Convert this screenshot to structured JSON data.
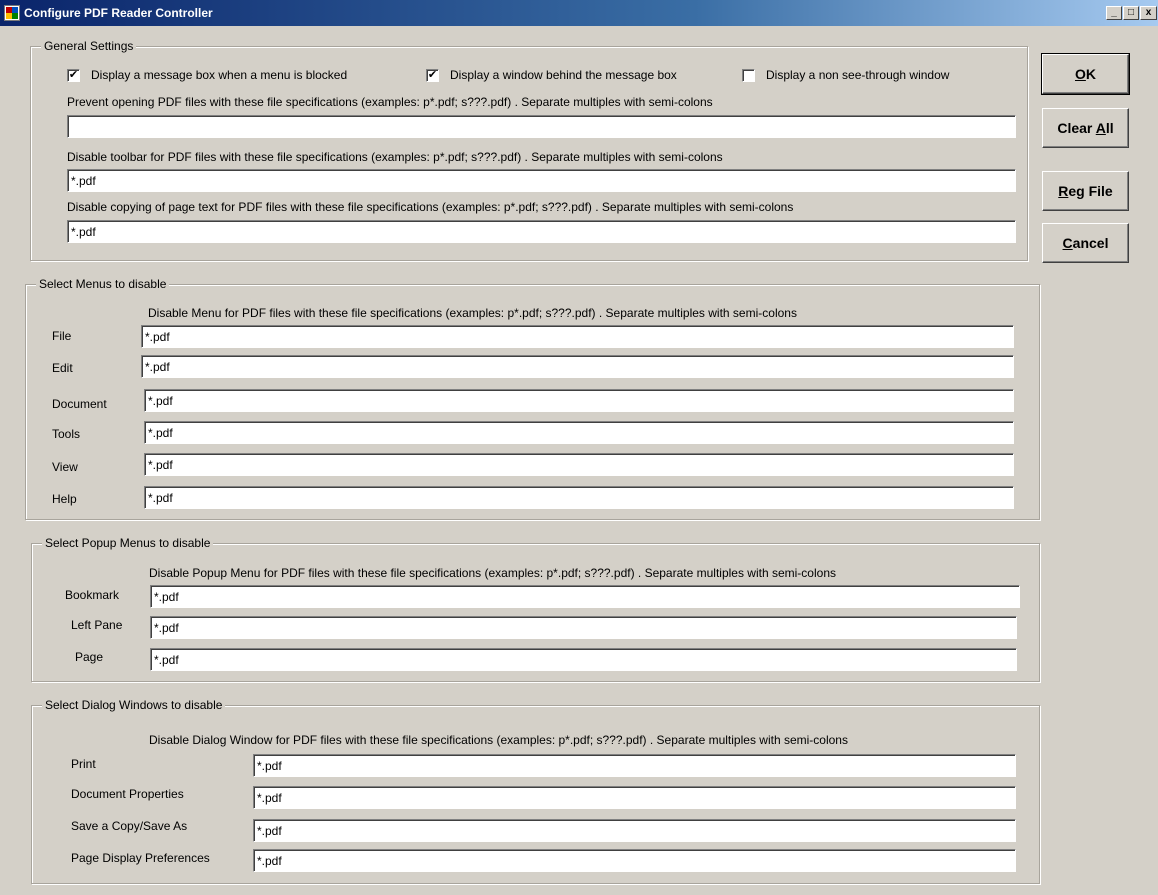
{
  "window": {
    "title": "Configure PDF Reader Controller",
    "minimize_glyph": "_",
    "maximize_glyph": "□",
    "close_glyph": "x"
  },
  "buttons": {
    "ok": {
      "accel": "O",
      "rest": "K"
    },
    "clear_all": {
      "pre": "Clear ",
      "accel": "A",
      "rest": "ll"
    },
    "reg_file": {
      "accel": "R",
      "rest": "eg File"
    },
    "cancel": {
      "accel": "C",
      "rest": "ancel"
    }
  },
  "general": {
    "legend": "General Settings",
    "checkboxes": [
      {
        "label": "Display a message box when a menu is blocked",
        "checked": true,
        "mark": "✔"
      },
      {
        "label": "Display a window behind the message box",
        "checked": true,
        "mark": "✔"
      },
      {
        "label": "Display a non see-through window",
        "checked": false,
        "mark": ""
      }
    ],
    "prevent_label": "Prevent opening PDF files with these file specifications (examples: p*.pdf; s???.pdf) . Separate multiples with semi-colons",
    "prevent_value": "",
    "toolbar_label": "Disable toolbar for PDF files with these file specifications (examples: p*.pdf; s???.pdf) . Separate multiples with semi-colons",
    "toolbar_value": "*.pdf",
    "copy_label": "Disable copying of page text for PDF files with these file specifications (examples: p*.pdf; s???.pdf) . Separate multiples with semi-colons",
    "copy_value": "*.pdf"
  },
  "menus": {
    "legend": "Select Menus to disable",
    "header": "Disable Menu for PDF files with these file specifications (examples: p*.pdf; s???.pdf) . Separate multiples with semi-colons",
    "rows": [
      {
        "label": "File",
        "value": "*.pdf"
      },
      {
        "label": "Edit",
        "value": "*.pdf"
      },
      {
        "label": "Document",
        "value": "*.pdf"
      },
      {
        "label": "Tools",
        "value": "*.pdf"
      },
      {
        "label": "View",
        "value": "*.pdf"
      },
      {
        "label": "Help",
        "value": "*.pdf"
      }
    ]
  },
  "popups": {
    "legend": "Select Popup Menus to disable",
    "header": "Disable Popup Menu for PDF files with these file specifications (examples: p*.pdf; s???.pdf) . Separate multiples with semi-colons",
    "rows": [
      {
        "label": "Bookmark",
        "value": "*.pdf"
      },
      {
        "label": "Left Pane",
        "value": "*.pdf"
      },
      {
        "label": "Page",
        "value": "*.pdf"
      }
    ]
  },
  "dialogs": {
    "legend": "Select Dialog Windows to disable",
    "header": "Disable Dialog Window for PDF files with these file specifications (examples: p*.pdf; s???.pdf) . Separate multiples with semi-colons",
    "rows": [
      {
        "label": "Print",
        "value": "*.pdf"
      },
      {
        "label": "Document Properties",
        "value": "*.pdf"
      },
      {
        "label": "Save a Copy/Save As",
        "value": "*.pdf"
      },
      {
        "label": "Page Display Preferences",
        "value": "*.pdf"
      }
    ]
  }
}
